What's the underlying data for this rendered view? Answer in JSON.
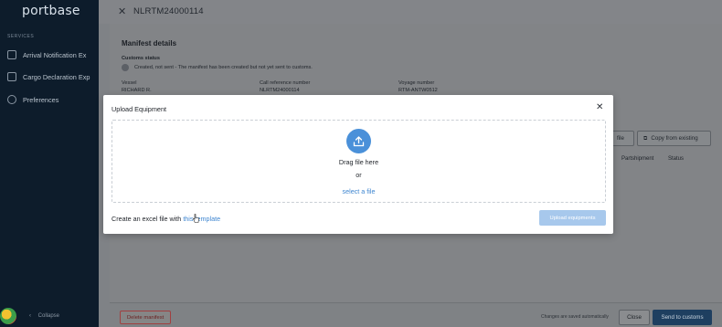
{
  "sidebar": {
    "logo": "portbase",
    "section_label": "SERVICES",
    "items": [
      {
        "label": "Arrival Notification Ex",
        "icon": "document-icon"
      },
      {
        "label": "Cargo Declaration Exp",
        "icon": "document-icon"
      },
      {
        "label": "Preferences",
        "icon": "gear-icon"
      }
    ],
    "collapse_label": "Collapse"
  },
  "header": {
    "title": "NLRTM24000114"
  },
  "manifest": {
    "heading": "Manifest details",
    "customs_status_label": "Customs status",
    "customs_status_text": "Created, not sent - The manifest has been created but not yet sent to customs.",
    "vessel_label": "Vessel",
    "vessel_value": "RICHARD R.",
    "callref_label": "Call reference number",
    "callref_value": "NLRTM24000114",
    "voyage_label": "Voyage number",
    "voyage_value": "RTM-ANTW0512",
    "file_button_label": "file",
    "copy_button_label": "Copy from existing",
    "columns": [
      "Partshipment",
      "Status"
    ]
  },
  "footer": {
    "delete_label": "Delete manifest",
    "autosave_text": "Changes are saved automatically",
    "close_label": "Close",
    "send_label": "Send to customs"
  },
  "modal": {
    "title": "Upload Equipment",
    "drag_text": "Drag file here",
    "or_text": "or",
    "select_file_text": "select a file",
    "template_prefix": "Create an excel file with",
    "template_link": "this template",
    "upload_button_label": "Upload equipments"
  },
  "colors": {
    "accent": "#4a90d9",
    "link": "#3d85d0",
    "sidebar_bg": "#0d1c2b",
    "primary_button": "#1e3f60",
    "upload_disabled": "#a7c8ec"
  }
}
